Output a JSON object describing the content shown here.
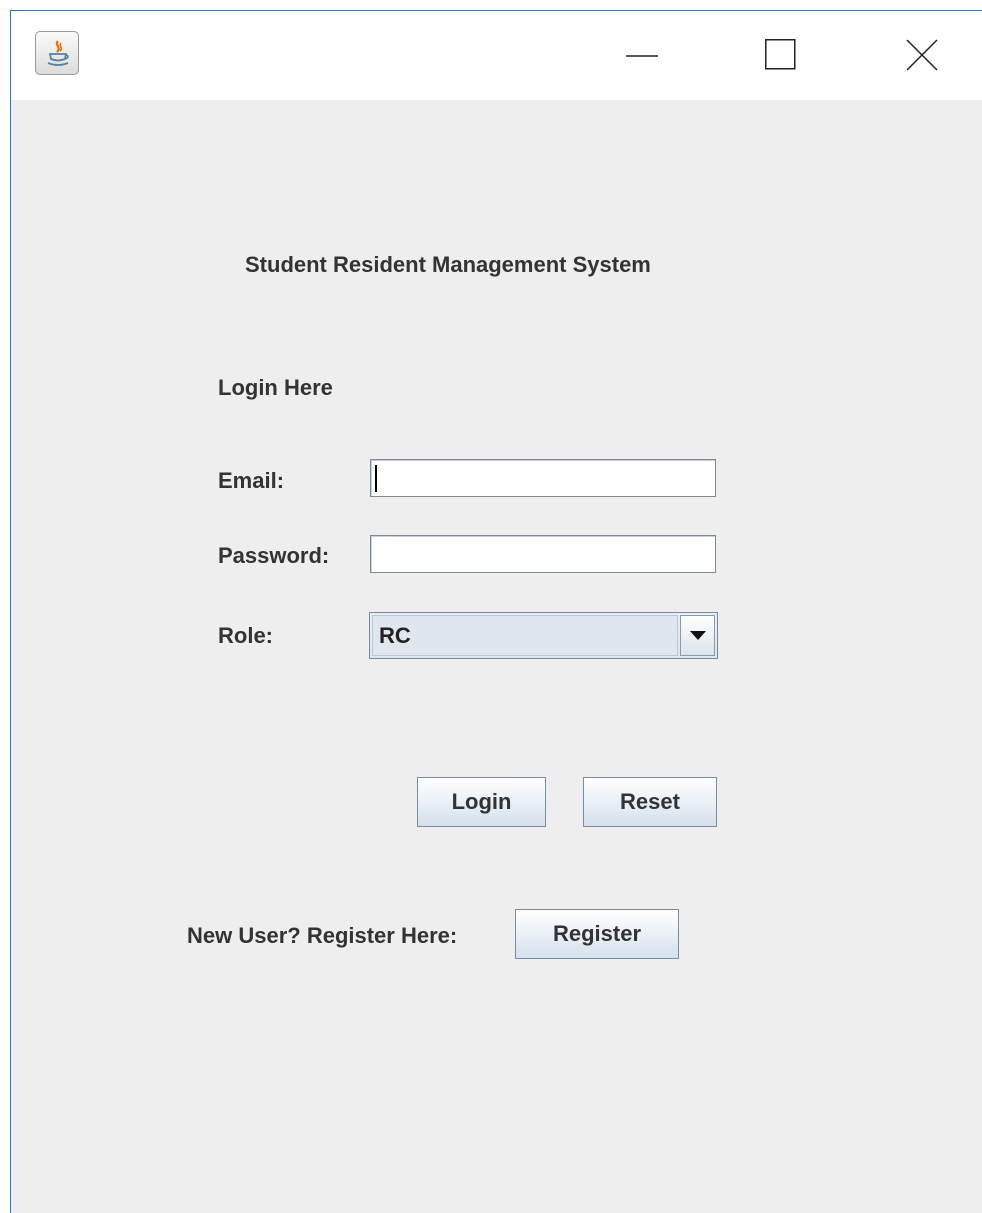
{
  "window": {
    "title": "",
    "icon": "java-cup-icon",
    "controls": {
      "minimize_icon": "minimize-icon",
      "maximize_icon": "maximize-icon",
      "close_icon": "close-icon"
    }
  },
  "form": {
    "title": "Student Resident Management System",
    "subtitle": "Login Here",
    "email_label": "Email:",
    "email_value": "",
    "password_label": "Password:",
    "password_value": "",
    "role_label": "Role:",
    "role_selected": "RC",
    "login_label": "Login",
    "reset_label": "Reset",
    "register_prompt": "New User? Register Here:",
    "register_label": "Register"
  },
  "colors": {
    "window_border": "#2b78d4",
    "background": "#eeeeee",
    "titlebar": "#ffffff"
  }
}
